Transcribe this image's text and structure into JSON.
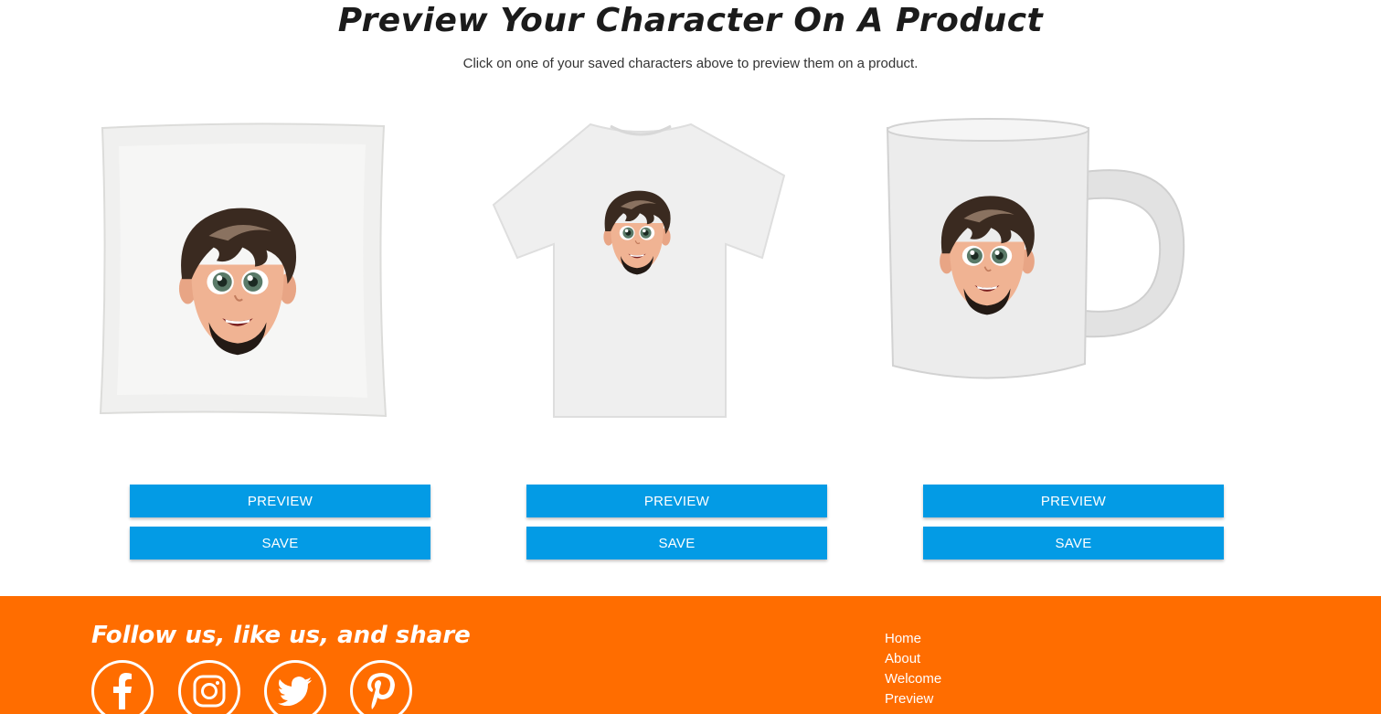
{
  "page": {
    "title": "Preview Your Character On A Product",
    "subtitle": "Click on one of your saved characters above to preview them on a product."
  },
  "products": [
    {
      "name": "pillow",
      "preview_label": "PREVIEW",
      "save_label": "SAVE"
    },
    {
      "name": "t-shirt",
      "preview_label": "PREVIEW",
      "save_label": "SAVE"
    },
    {
      "name": "mug",
      "preview_label": "PREVIEW",
      "save_label": "SAVE"
    }
  ],
  "footer": {
    "follow_text": "Follow us, like us, and share",
    "social": [
      "facebook-icon",
      "instagram-icon",
      "twitter-icon",
      "pinterest-icon"
    ],
    "links": [
      "Home",
      "About",
      "Welcome",
      "Preview"
    ]
  },
  "colors": {
    "button": "#039be5",
    "footer": "#ff6d00"
  }
}
